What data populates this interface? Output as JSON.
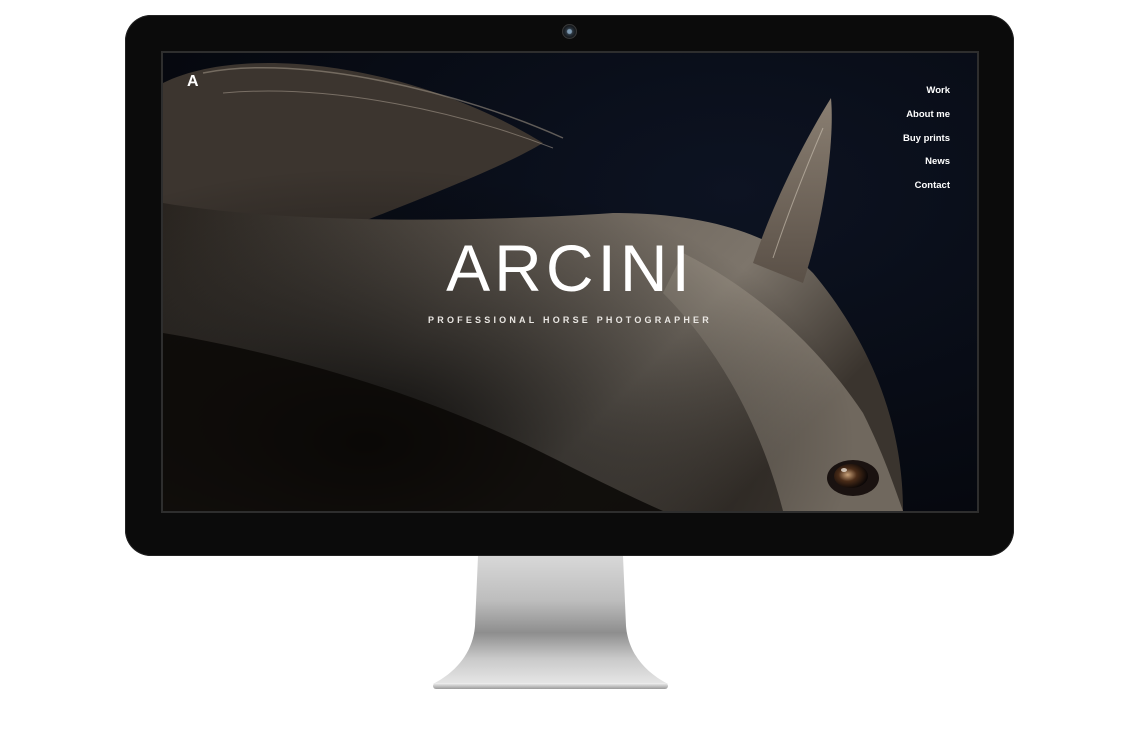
{
  "site": {
    "logo": "A",
    "title": "ARCINI",
    "subtitle": "PROFESSIONAL HORSE PHOTOGRAPHER"
  },
  "nav": {
    "items": [
      {
        "label": "Work"
      },
      {
        "label": "About me"
      },
      {
        "label": "Buy prints"
      },
      {
        "label": "News"
      },
      {
        "label": "Contact"
      }
    ]
  },
  "colors": {
    "background": "#05070d",
    "text": "#ffffff",
    "bezel": "#0b0b0b"
  },
  "icons": {
    "camera": "webcam-icon",
    "hero": "horse-photo"
  }
}
